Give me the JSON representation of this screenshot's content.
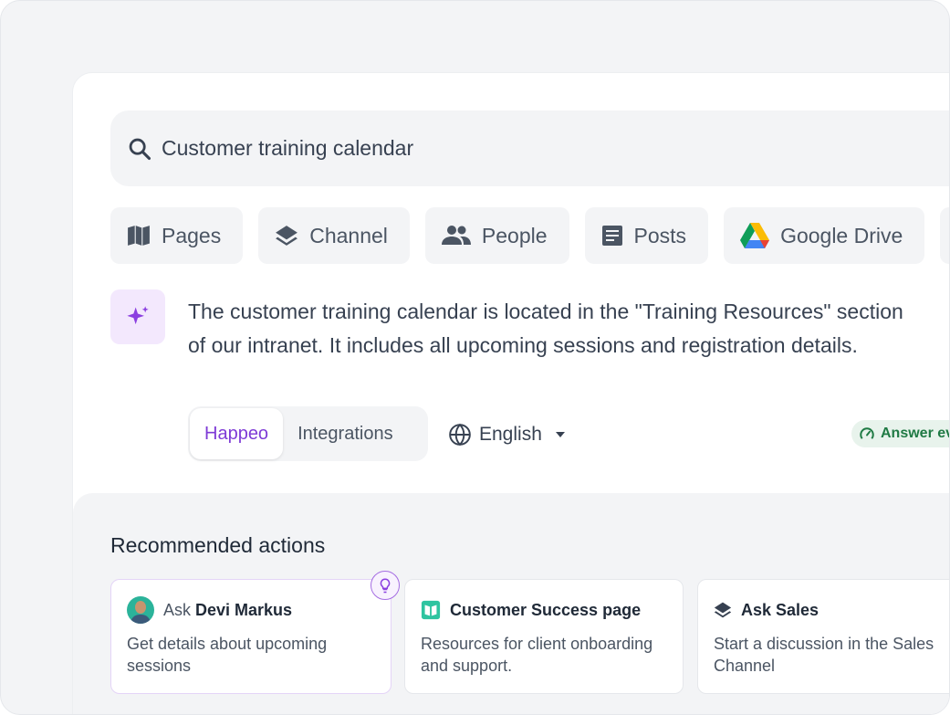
{
  "search": {
    "query": "Customer training calendar",
    "icon": "search-icon"
  },
  "filters": [
    {
      "label": "Pages",
      "icon": "book-icon"
    },
    {
      "label": "Channel",
      "icon": "layers-icon"
    },
    {
      "label": "People",
      "icon": "people-icon"
    },
    {
      "label": "Posts",
      "icon": "document-icon"
    },
    {
      "label": "Google Drive",
      "icon": "google-drive-icon"
    }
  ],
  "ai_answer": {
    "icon": "sparkle-icon",
    "line1": "The customer training calendar is located in the \"Training Resources\" section",
    "line2": "of our intranet. It includes all upcoming sessions and registration details."
  },
  "source_toggle": {
    "options": [
      "Happeo",
      "Integrations"
    ],
    "selected": "Happeo"
  },
  "language": {
    "value": "English",
    "icon": "globe-icon"
  },
  "answer_badge": {
    "label": "Answer ev",
    "icon": "gauge-icon"
  },
  "recommended": {
    "title": "Recommended actions",
    "cards": [
      {
        "prefix": "Ask",
        "title": "Devi Markus",
        "desc": "Get details about upcoming sessions",
        "icon": "avatar"
      },
      {
        "prefix": "",
        "title": "Customer Success page",
        "desc": "Resources for client onboarding and support.",
        "icon": "book-icon"
      },
      {
        "prefix": "",
        "title": "Ask Sales",
        "desc": "Start a discussion in the Sales Channel",
        "icon": "layers-icon"
      }
    ]
  },
  "colors": {
    "accent": "#7e3bd6",
    "badge_green": "#1f7a44",
    "bg": "#f3f4f6"
  }
}
